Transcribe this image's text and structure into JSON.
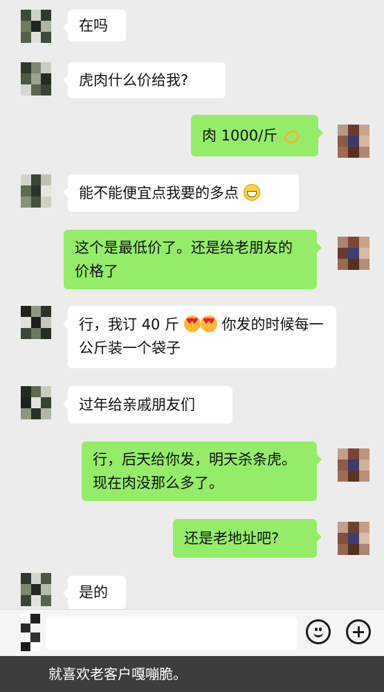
{
  "messages": [
    {
      "side": "in",
      "text": "在吗"
    },
    {
      "side": "in",
      "text": "虎肉什么价给我?"
    },
    {
      "side": "out",
      "text": "肉 1000/斤",
      "emoji": "ok-hand-icon"
    },
    {
      "side": "in",
      "text": "能不能便宜点我要的多点",
      "emoji": "grin-icon"
    },
    {
      "side": "out",
      "text": "这个是最低价了。还是给老朋友的价格了"
    },
    {
      "side": "in",
      "text_a": "行，我订 40 斤",
      "emoji": "heart-eyes-icon",
      "text_b": "你发的时候每一公斤装一个袋子"
    },
    {
      "side": "in",
      "text": "过年给亲戚朋友们"
    },
    {
      "side": "out",
      "text": "行，后天给你发，明天杀条虎。现在肉没那么多了。"
    },
    {
      "side": "out",
      "text": "还是老地址吧?"
    },
    {
      "side": "in",
      "text": "是的"
    }
  ],
  "input_bar": {
    "emoji_button": "smile-icon",
    "more_button": "plus-icon"
  },
  "caption": "就喜欢老客户嘎嘣脆。",
  "colors": {
    "incoming_bubble": "#ffffff",
    "outgoing_bubble": "#95ec69",
    "background": "#ececec",
    "caption_bar": "#3d3d3d"
  }
}
